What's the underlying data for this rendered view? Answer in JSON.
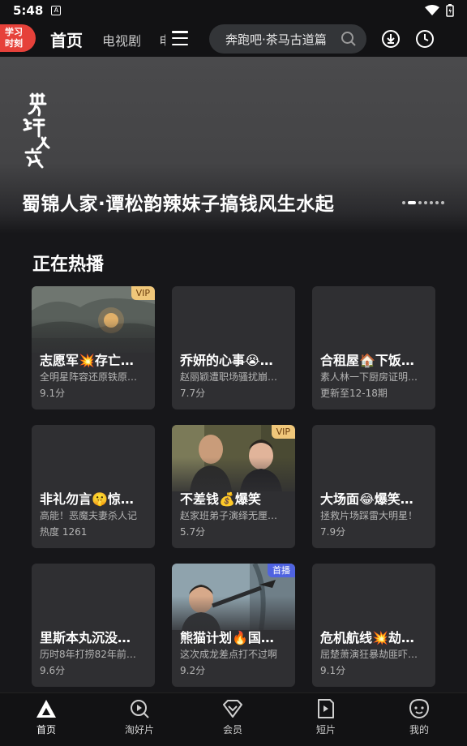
{
  "status_bar": {
    "time": "5:48",
    "notif_glyph": "A"
  },
  "top_nav": {
    "badge": [
      "学习",
      "时刻"
    ],
    "tabs": [
      {
        "label": "首页",
        "active": true
      },
      {
        "label": "电视剧",
        "active": false
      },
      {
        "label": "电",
        "active": false
      }
    ],
    "search_text": "奔跑吧·茶马古道篇"
  },
  "banner": {
    "logo_text": "蜀锦人家",
    "title": "蜀锦人家·谭松韵辣妹子搞钱风生水起",
    "dots": 7,
    "active_dot": 1
  },
  "section": {
    "title": "正在热播",
    "cards": [
      {
        "title": "志愿军💥存亡…",
        "subtitle": "全明星阵容还原铁原…",
        "meta": "9.1分",
        "tag": "VIP",
        "thumb": "war"
      },
      {
        "title": "乔妍的心事😭…",
        "subtitle": "赵丽颖遭职场骚扰崩…",
        "meta": "7.7分",
        "tag": "",
        "thumb": ""
      },
      {
        "title": "合租屋🏠下饭…",
        "subtitle": "素人林一下厨房证明…",
        "meta": "更新至12-18期",
        "tag": "",
        "thumb": ""
      },
      {
        "title": "非礼勿言🤫惊…",
        "subtitle": "高能！恶魔夫妻杀人记",
        "meta": "热度 1261",
        "tag": "",
        "thumb": ""
      },
      {
        "title": "不差钱💰爆笑",
        "subtitle": "赵家班弟子演绎无厘…",
        "meta": "5.7分",
        "tag": "VIP",
        "thumb": "comedy"
      },
      {
        "title": "大场面😂爆笑…",
        "subtitle": "拯救片场踩雷大明星！",
        "meta": "7.9分",
        "tag": "",
        "thumb": ""
      },
      {
        "title": "里斯本丸沉没…",
        "subtitle": "历时8年打捞82年前…",
        "meta": "9.6分",
        "tag": "",
        "thumb": ""
      },
      {
        "title": "熊猫计划🔥国…",
        "subtitle": "这次成龙差点打不过啊",
        "meta": "9.2分",
        "tag": "首播",
        "thumb": "action"
      },
      {
        "title": "危机航线💥劫…",
        "subtitle": "屈楚萧演狂暴劫匪吓…",
        "meta": "9.1分",
        "tag": "",
        "thumb": ""
      }
    ]
  },
  "bottom_nav": [
    {
      "label": "首页",
      "icon": "home-icon",
      "active": true
    },
    {
      "label": "淘好片",
      "icon": "discover-icon",
      "active": false
    },
    {
      "label": "会员",
      "icon": "vip-diamond-icon",
      "active": false
    },
    {
      "label": "短片",
      "icon": "short-video-icon",
      "active": false
    },
    {
      "label": "我的",
      "icon": "profile-icon",
      "active": false
    }
  ],
  "colors": {
    "accent_red": "#e6413a",
    "vip_gold": "#f0c77a",
    "premiere_blue": "#4f63e0",
    "background": "#17171a"
  }
}
